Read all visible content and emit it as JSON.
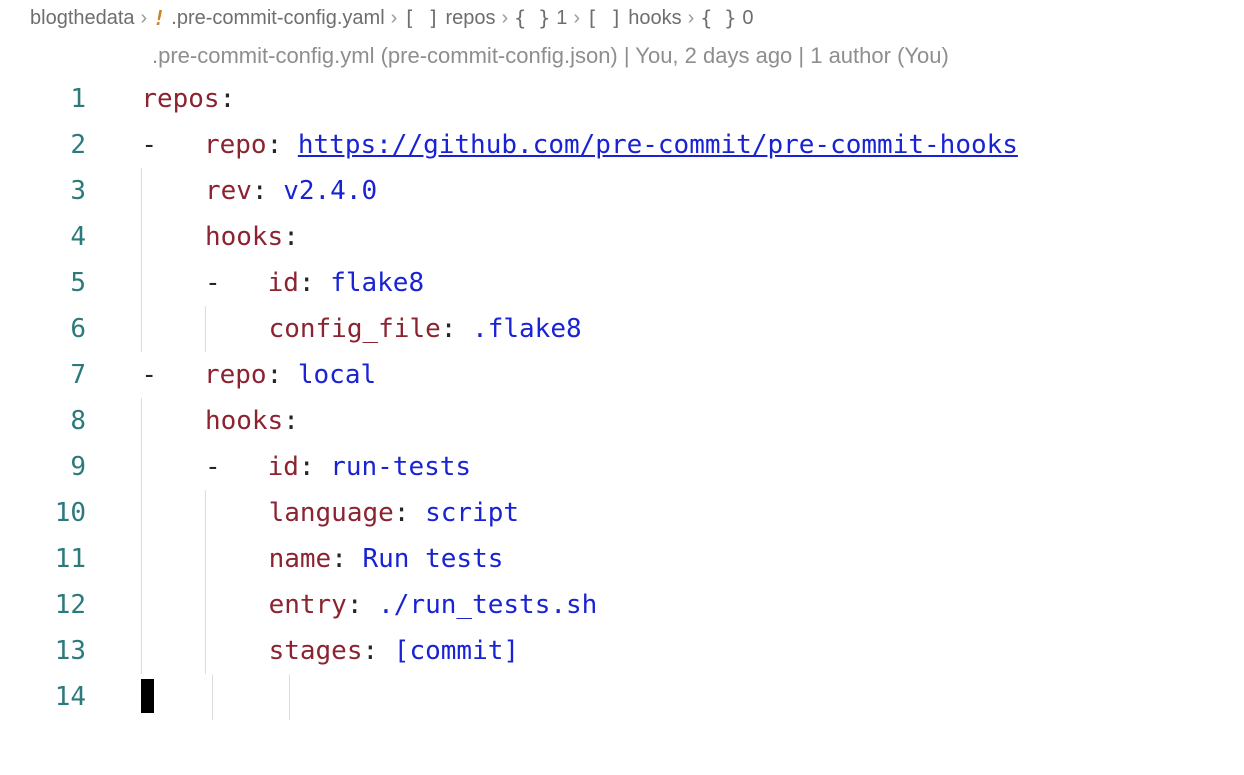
{
  "breadcrumb": {
    "root": "blogthedata",
    "file": ".pre-commit-config.yaml",
    "path": [
      "repos",
      "1",
      "hooks",
      "0"
    ],
    "symbols": [
      "[ ]",
      "{ }",
      "[ ]",
      "{ }"
    ]
  },
  "codelens": ".pre-commit-config.yml (pre-commit-config.json) | You, 2 days ago | 1 author (You)",
  "line_numbers": [
    "1",
    "2",
    "3",
    "4",
    "5",
    "6",
    "7",
    "8",
    "9",
    "10",
    "11",
    "12",
    "13",
    "14"
  ],
  "code": {
    "l1_key": "repos",
    "l2_key": "repo",
    "l2_val": "https://github.com/pre-commit/pre-commit-hooks",
    "l3_key": "rev",
    "l3_val": "v2.4.0",
    "l4_key": "hooks",
    "l5_key": "id",
    "l5_val": "flake8",
    "l6_key": "config_file",
    "l6_val": ".flake8",
    "l7_key": "repo",
    "l7_val": "local",
    "l8_key": "hooks",
    "l9_key": "id",
    "l9_val": "run-tests",
    "l10_key": "language",
    "l10_val": "script",
    "l11_key": "name",
    "l11_val": "Run tests",
    "l12_key": "entry",
    "l12_val": "./run_tests.sh",
    "l13_key": "stages",
    "l13_val": "[commit]"
  },
  "dash": "-",
  "colon": ":"
}
